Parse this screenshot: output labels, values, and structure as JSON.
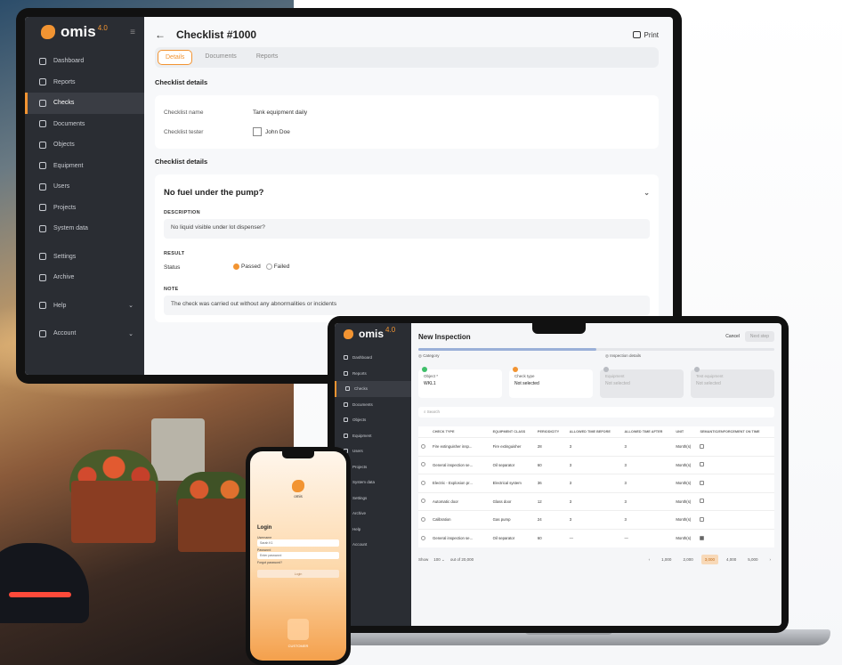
{
  "monitor": {
    "app_name": "omis",
    "version": "4.0",
    "sidebar": [
      {
        "label": "Dashboard",
        "icon": "dashboard-icon"
      },
      {
        "label": "Reports",
        "icon": "reports-icon"
      },
      {
        "label": "Checks",
        "icon": "checks-icon",
        "active": true
      },
      {
        "label": "Documents",
        "icon": "documents-icon"
      },
      {
        "label": "Objects",
        "icon": "objects-icon"
      },
      {
        "label": "Equipment",
        "icon": "equipment-icon"
      },
      {
        "label": "Users",
        "icon": "users-icon"
      },
      {
        "label": "Projects",
        "icon": "projects-icon"
      },
      {
        "label": "System data",
        "icon": "system-data-icon"
      },
      {
        "label": "Settings",
        "icon": "settings-icon"
      },
      {
        "label": "Archive",
        "icon": "archive-icon"
      },
      {
        "label": "Help",
        "icon": "help-icon"
      },
      {
        "label": "Account",
        "icon": "account-icon"
      }
    ],
    "title": "Checklist #1000",
    "print_label": "Print",
    "tabs": [
      "Details",
      "Documents",
      "Reports"
    ],
    "section1": "Checklist details",
    "fields": {
      "name_label": "Checklist name",
      "name_value": "Tank equipment daily",
      "tester_label": "Checklist tester",
      "tester_value": "John Doe"
    },
    "section2": "Checklist details",
    "question": "No fuel under the pump?",
    "description_label": "DESCRIPTION",
    "description": "No liquid visible under lot dispenser?",
    "result_label": "RESULT",
    "status_label": "Status",
    "status_options": [
      "Passed",
      "Failed"
    ],
    "note_label": "NOTE",
    "note": "The check was carried out without any abnormalities or incidents"
  },
  "laptop": {
    "app_name": "omis",
    "version": "4.0",
    "sidebar": [
      "Dashboard",
      "Reports",
      "Checks",
      "Documents",
      "Objects",
      "Equipment",
      "Users",
      "Projects",
      "System data",
      "Settings",
      "Archive",
      "Help",
      "Account"
    ],
    "title": "New Inspection",
    "cancel": "Cancel",
    "next": "Next step",
    "progress": 0.5,
    "steps": [
      "Category",
      "Inspection details"
    ],
    "cards": [
      {
        "label": "Object *",
        "value": "WKL1",
        "dot": "#3fbf6a"
      },
      {
        "label": "Check type",
        "value": "Not selected",
        "dot": "#f29432"
      },
      {
        "label": "Equipment",
        "value": "Not selected",
        "dot": "#b9bcc2",
        "disabled": true
      },
      {
        "label": "Test equipment",
        "value": "Not selected",
        "dot": "#b9bcc2",
        "disabled": true
      }
    ],
    "search_placeholder": "Search",
    "columns": [
      "",
      "CHECK TYPE",
      "",
      "EQUIPMENT CLASS",
      "PERIODICITY",
      "ALLOWED TIME BEFORE",
      "ALLOWED TIME AFTER",
      "UNIT",
      "SEMANTIC/ENFORCEMENT ON TIME"
    ],
    "rows": [
      {
        "type": "Fire extinguisher insp...",
        "class": "Fire extinguisher",
        "period": "28",
        "before": "3",
        "after": "3",
        "unit": "Month(s)",
        "checked": false
      },
      {
        "type": "General inspection se...",
        "class": "Oil separator",
        "period": "60",
        "before": "3",
        "after": "3",
        "unit": "Month(s)",
        "checked": false
      },
      {
        "type": "Electric - Explosion pr...",
        "class": "Electrical system",
        "period": "36",
        "before": "3",
        "after": "3",
        "unit": "Month(s)",
        "checked": false
      },
      {
        "type": "Automatic door",
        "class": "Glass door",
        "period": "12",
        "before": "3",
        "after": "3",
        "unit": "Month(s)",
        "checked": false
      },
      {
        "type": "Calibration",
        "class": "Gas pump",
        "period": "24",
        "before": "3",
        "after": "3",
        "unit": "Month(s)",
        "checked": false
      },
      {
        "type": "General inspection se...",
        "class": "Oil separator",
        "period": "60",
        "before": "—",
        "after": "—",
        "unit": "Month(s)",
        "checked": true
      }
    ],
    "pager": {
      "show_label": "Show",
      "per_page": "100",
      "range": "out of 20,000",
      "pages": [
        "1,000",
        "2,000",
        "3,000",
        "4,000",
        "5,000"
      ],
      "active_page": "3,000"
    }
  },
  "phone": {
    "login_title": "Login",
    "username_label": "Username",
    "username_value": "Sarah K1",
    "password_label": "Password",
    "password_value": "Enter password",
    "forgot": "Forgot password?",
    "button": "Login",
    "footer": "CUSTOMER"
  }
}
